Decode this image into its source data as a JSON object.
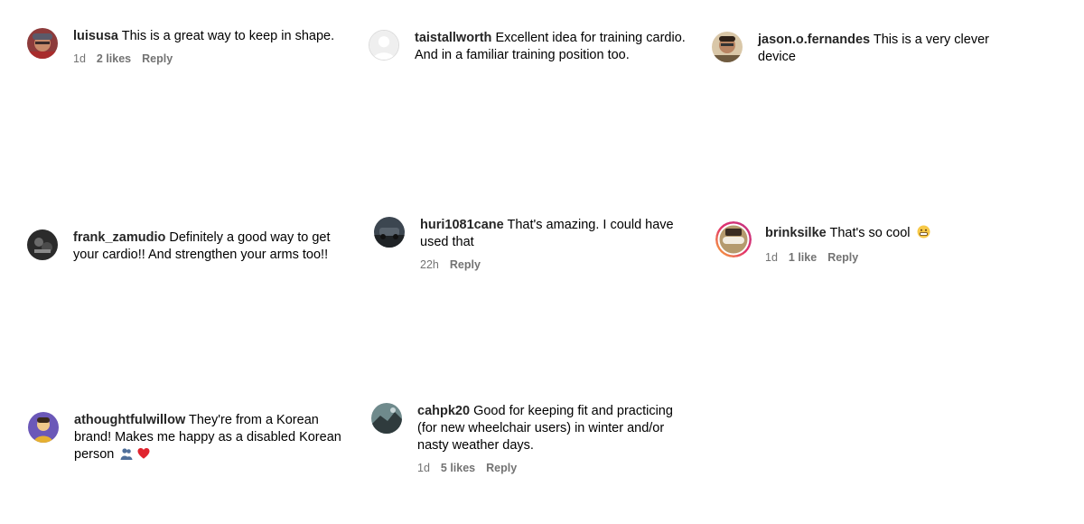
{
  "comments": [
    {
      "username": "luisusa",
      "text": "This is a great way to keep in shape.",
      "time": "1d",
      "likes": "2 likes",
      "reply": "Reply",
      "avatar_icon": "user-photo-icon"
    },
    {
      "username": "taistallworth",
      "text": "Excellent idea for training cardio. And in a familiar training position too.",
      "avatar_icon": "default-avatar-icon"
    },
    {
      "username": "jason.o.fernandes",
      "text": "This is a very clever device",
      "avatar_icon": "user-photo-icon"
    },
    {
      "username": "frank_zamudio",
      "text": "Definitely a good way to get your cardio!! And strengthen your arms too!!",
      "avatar_icon": "user-photo-icon"
    },
    {
      "username": "huri1081cane",
      "text": "That's amazing. I could have used that",
      "time": "22h",
      "reply": "Reply",
      "avatar_icon": "user-photo-icon"
    },
    {
      "username": "brinksilke",
      "text": "That's so cool",
      "time": "1d",
      "likes": "1 like",
      "reply": "Reply",
      "avatar_icon": "story-ring-avatar-icon"
    },
    {
      "username": "athoughtfulwillow",
      "text": "They're from a Korean brand! Makes me happy as a disabled Korean person",
      "avatar_icon": "user-photo-icon"
    },
    {
      "username": "cahpk20",
      "text": "Good for keeping fit and practicing (for new wheelchair users) in winter and/or nasty weather days.",
      "time": "1d",
      "likes": "5 likes",
      "reply": "Reply",
      "avatar_icon": "user-photo-icon"
    }
  ],
  "colors": {
    "username": "#262626",
    "meta": "#737373",
    "text": "#000000"
  }
}
